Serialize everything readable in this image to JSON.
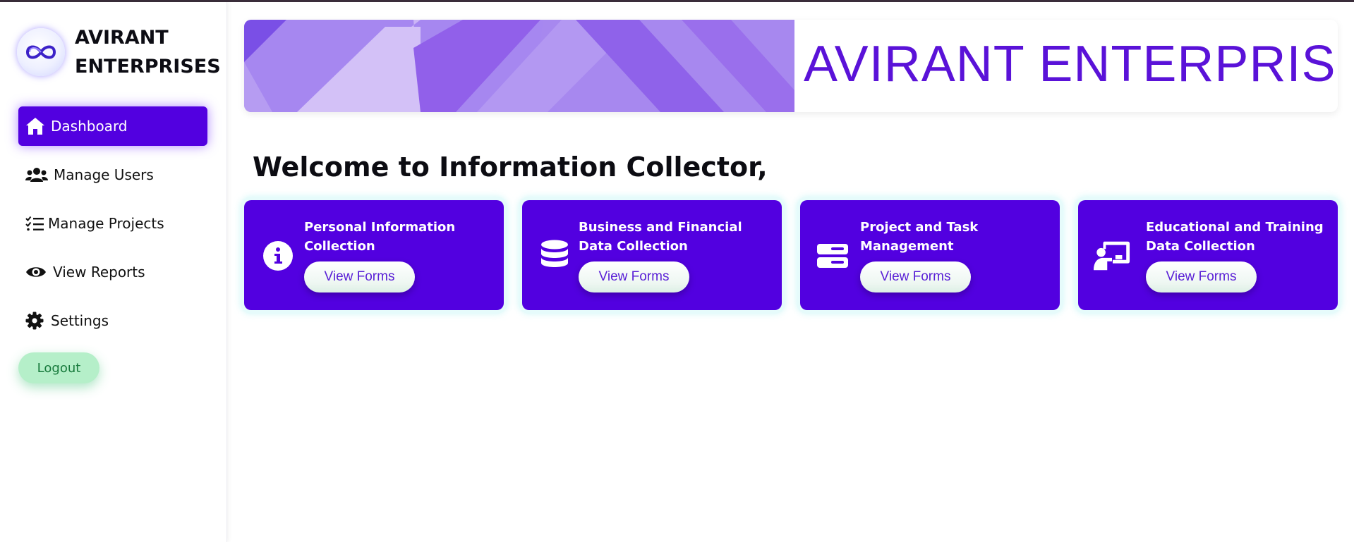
{
  "brand": {
    "line1": "AVIRANT",
    "line2": "ENTERPRISES",
    "logo_icon": "infinity-logo-icon"
  },
  "sidebar": {
    "items": [
      {
        "label": "Dashboard",
        "icon": "home-icon",
        "active": true
      },
      {
        "label": "Manage Users",
        "icon": "users-icon",
        "active": false
      },
      {
        "label": "Manage Projects",
        "icon": "checklist-icon",
        "active": false
      },
      {
        "label": "View Reports",
        "icon": "eye-icon",
        "active": false
      },
      {
        "label": "Settings",
        "icon": "gear-icon",
        "active": false
      }
    ],
    "logout_label": "Logout"
  },
  "banner": {
    "title": "AVIRANT ENTERPRISES"
  },
  "main": {
    "welcome": "Welcome to Information Collector,",
    "cards": [
      {
        "title": "Personal Information Collection",
        "button": "View Forms",
        "icon": "info-icon"
      },
      {
        "title": "Business and Financial Data Collection",
        "button": "View Forms",
        "icon": "database-icon"
      },
      {
        "title": "Project and Task Management",
        "button": "View Forms",
        "icon": "server-icon"
      },
      {
        "title": "Educational and Training Data Collection",
        "button": "View Forms",
        "icon": "teacher-board-icon"
      }
    ]
  },
  "colors": {
    "accent": "#5200e0",
    "banner_text": "#5a12d8",
    "logout_bg": "#b5efc9",
    "logout_text": "#177a3c"
  }
}
